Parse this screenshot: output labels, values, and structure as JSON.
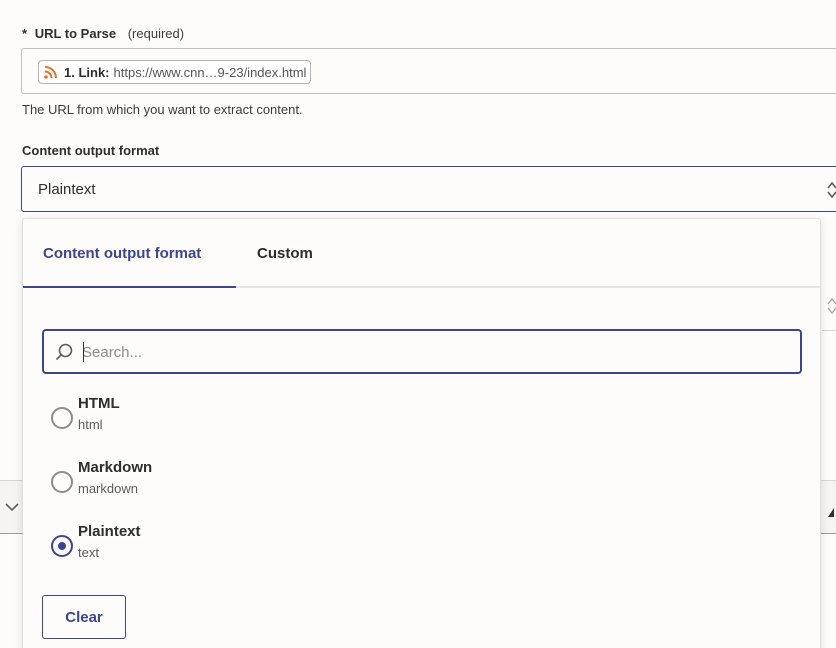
{
  "url_field": {
    "required_marker": "*",
    "label": "URL to Parse",
    "required_text": "(required)",
    "pill": {
      "icon": "rss-icon",
      "key": "1. Link:",
      "value": "https://www.cnn…9-23/index.html"
    },
    "help_text": "The URL from which you want to extract content."
  },
  "format_field": {
    "label": "Content output format",
    "selected_value": "Plaintext",
    "icon": "chevron-up-down-icon"
  },
  "dropdown": {
    "tabs": [
      {
        "label": "Content output format",
        "active": true
      },
      {
        "label": "Custom",
        "active": false
      }
    ],
    "search": {
      "placeholder": "Search...",
      "value": ""
    },
    "options": [
      {
        "label": "HTML",
        "value": "html",
        "selected": false
      },
      {
        "label": "Markdown",
        "value": "markdown",
        "selected": false
      },
      {
        "label": "Plaintext",
        "value": "text",
        "selected": true
      }
    ],
    "clear_label": "Clear"
  },
  "colors": {
    "accent": "#3d4592",
    "rss": "#e8702a",
    "text": "#2d2e2e",
    "background": "#fdfcfa"
  }
}
